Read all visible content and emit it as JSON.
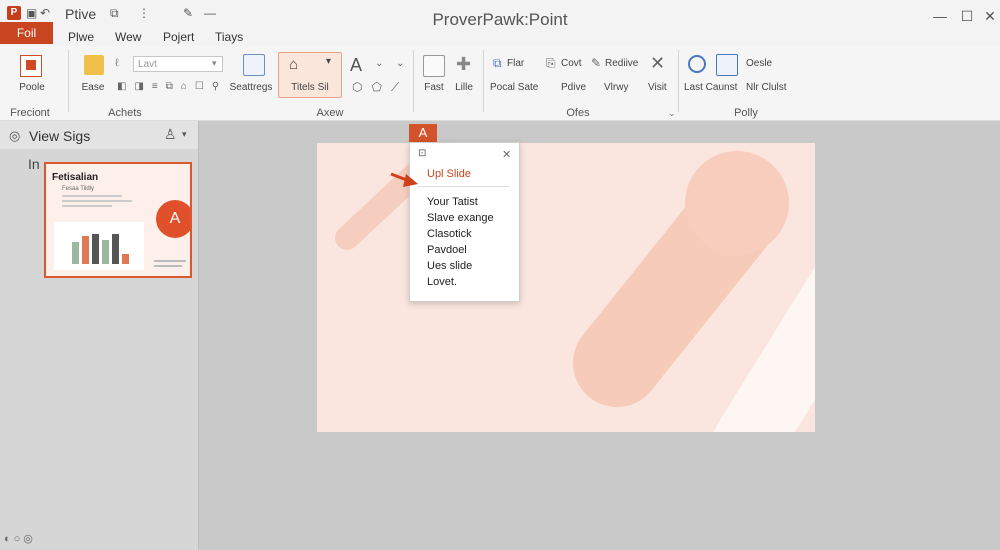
{
  "window": {
    "doc_title": "Ptive",
    "app_title": "ProverPawk:Point",
    "app_icon": "P"
  },
  "tabs": {
    "file": "Foil",
    "items": [
      "Plwe",
      "Wew",
      "Pojert",
      "Tiays"
    ]
  },
  "ribbon": {
    "buttons": {
      "people": "Poole",
      "ease": "Ease",
      "font_value": "Lavt",
      "seattregs": "Seattregs",
      "titles": "Titels Sil",
      "fast": "Fast",
      "lille": "Lille",
      "flar": "Flar",
      "covt": "Covt",
      "redive": "Rediive",
      "pocal_sate": "Pocal Sate",
      "pdive": "Pdive",
      "vlrwy": "Vlrwy",
      "visit": "Visit",
      "last_caunst": "Last Caunst",
      "oesle": "Oesle",
      "nlr_clulst": "Nlr Clulst"
    },
    "groups": [
      "Freciont",
      "Achets",
      "Axew",
      "Ofes",
      "Polly"
    ]
  },
  "left_pane": {
    "header": "View Sigs",
    "label": "In",
    "thumb": {
      "title": "Fetisalian",
      "subtitle": "Fesaa Tildly",
      "badge": "A"
    }
  },
  "popup": {
    "badge": "A",
    "highlight": "Upl Slide",
    "items": [
      "Your Tatist",
      "Slave exange",
      "Clasotick",
      "Pavdoel",
      "Ues slide",
      "Lovet."
    ]
  },
  "colors": {
    "accent": "#c9451f",
    "slide_bg": "#fae6de"
  }
}
